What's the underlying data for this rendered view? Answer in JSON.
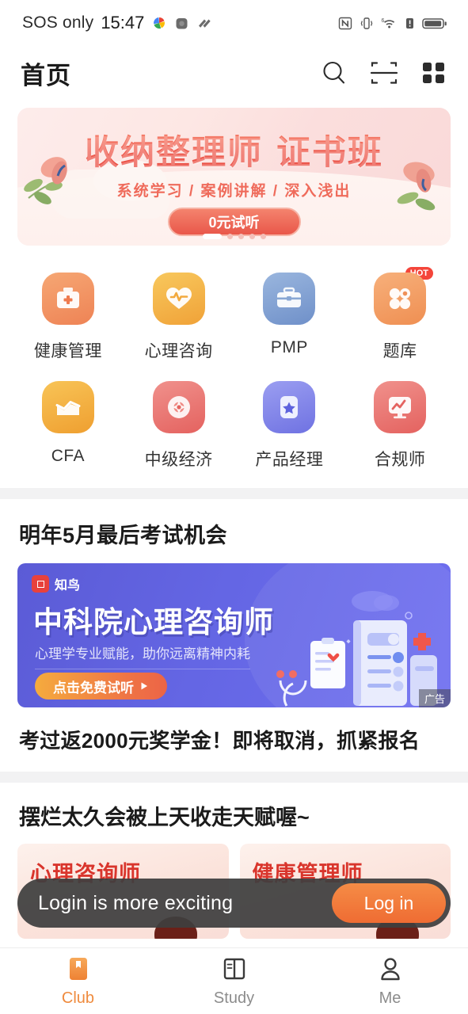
{
  "status_bar": {
    "carrier": "SOS only",
    "time": "15:47",
    "left_icons": [
      "photos-icon",
      "camera-icon",
      "clipboard-icon"
    ],
    "right_icons": [
      "nfc-icon",
      "vibrate-icon",
      "wifi6-icon",
      "sim-alert-icon",
      "battery-icon"
    ]
  },
  "header": {
    "title": "首页",
    "icons": [
      "search-icon",
      "scan-icon",
      "grid-menu-icon"
    ]
  },
  "banner": {
    "title": "收纳整理师 证书班",
    "subtitle": "系统学习 / 案例讲解 / 深入浅出",
    "button": "0元试听",
    "dots_total": 5,
    "dots_active_index": 0,
    "bg_color": "#fbdedd",
    "accent_color": "#e9574a"
  },
  "quick_grid": {
    "items": [
      {
        "label": "健康管理",
        "icon": "medical-kit-icon",
        "color": "#f4965f",
        "badge": ""
      },
      {
        "label": "心理咨询",
        "icon": "heart-pulse-icon",
        "color": "#f5b642",
        "badge": ""
      },
      {
        "label": "PMP",
        "icon": "briefcase-icon",
        "color": "#7d9fd4",
        "badge": ""
      },
      {
        "label": "题库",
        "icon": "question-bank-icon",
        "color": "#f49a5c",
        "badge": "HOT"
      },
      {
        "label": "CFA",
        "icon": "chart-growth-icon",
        "color": "#f5b63f",
        "badge": ""
      },
      {
        "label": "中级经济",
        "icon": "compass-icon",
        "color": "#ea6f6b",
        "badge": ""
      },
      {
        "label": "产品经理",
        "icon": "star-card-icon",
        "color": "#7c80e8",
        "badge": ""
      },
      {
        "label": "合规师",
        "icon": "monitor-chart-icon",
        "color": "#ea6f6b",
        "badge": ""
      }
    ]
  },
  "exam_section": {
    "title": "明年5月最后考试机会",
    "ad": {
      "brand": "知鸟",
      "title": "中科院心理咨询师",
      "subtitle": "心理学专业赋能，助你远离精神内耗",
      "button": "点击免费试听",
      "tag": "广告",
      "bg_color": "#6466e4"
    },
    "promo_line": "考过返2000元奖学金！即将取消，抓紧报名"
  },
  "courses_section": {
    "title": "摆烂太久会被上天收走天赋喔~",
    "cards": [
      {
        "title": "心理咨询师"
      },
      {
        "title": "健康管理师"
      }
    ]
  },
  "login_toast": {
    "message": "Login is more exciting",
    "button": "Log in",
    "button_color": "#ef6c33"
  },
  "tabbar": {
    "items": [
      {
        "label": "Club",
        "icon": "bookmark-icon",
        "active": true
      },
      {
        "label": "Study",
        "icon": "panels-icon",
        "active": false
      },
      {
        "label": "Me",
        "icon": "person-icon",
        "active": false
      }
    ],
    "active_color": "#ef8b3e"
  }
}
